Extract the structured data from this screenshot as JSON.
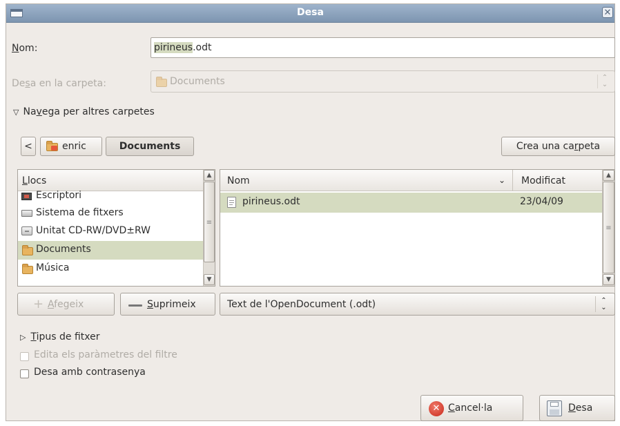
{
  "window": {
    "title": "Desa"
  },
  "name_row": {
    "label": "Nom:",
    "value_selected": "pirineus",
    "value_rest": ".odt"
  },
  "folder_row": {
    "label": "Desa en la carpeta:",
    "value": "Documents"
  },
  "expander": {
    "label": "Navega per altres carpetes"
  },
  "path_bar": {
    "back": "<",
    "crumbs": [
      "enric",
      "Documents"
    ],
    "create_folder": "Crea una carpeta"
  },
  "places": {
    "header": "Llocs",
    "items": [
      {
        "label": "Escriptori",
        "icon": "desktop-icon"
      },
      {
        "label": "Sistema de fitxers",
        "icon": "drive-icon"
      },
      {
        "label": "Unitat CD-RW/DVD±RW",
        "icon": "cdrom-icon"
      },
      {
        "label": "Documents",
        "icon": "folder-icon",
        "selected": true
      },
      {
        "label": "Música",
        "icon": "folder-icon"
      }
    ],
    "add_button": "Afegeix",
    "remove_button": "Suprimeix"
  },
  "files": {
    "columns": {
      "name": "Nom",
      "modified": "Modificat"
    },
    "rows": [
      {
        "name": "pirineus.odt",
        "modified": "23/04/09",
        "selected": true
      }
    ],
    "filter": "Text de l'OpenDocument (.odt)"
  },
  "file_type_expander": "Tipus de fitxer",
  "options": [
    {
      "label": "Edita els paràmetres del filtre",
      "checked": false,
      "disabled": true
    },
    {
      "label": "Desa amb contrasenya",
      "checked": false,
      "disabled": false
    }
  ],
  "actions": {
    "cancel": "Cancel·la",
    "save": "Desa"
  },
  "colors": {
    "titlebar": "#8ba2bd",
    "selection": "#d5dbc0",
    "dialog_bg": "#efebe7"
  }
}
